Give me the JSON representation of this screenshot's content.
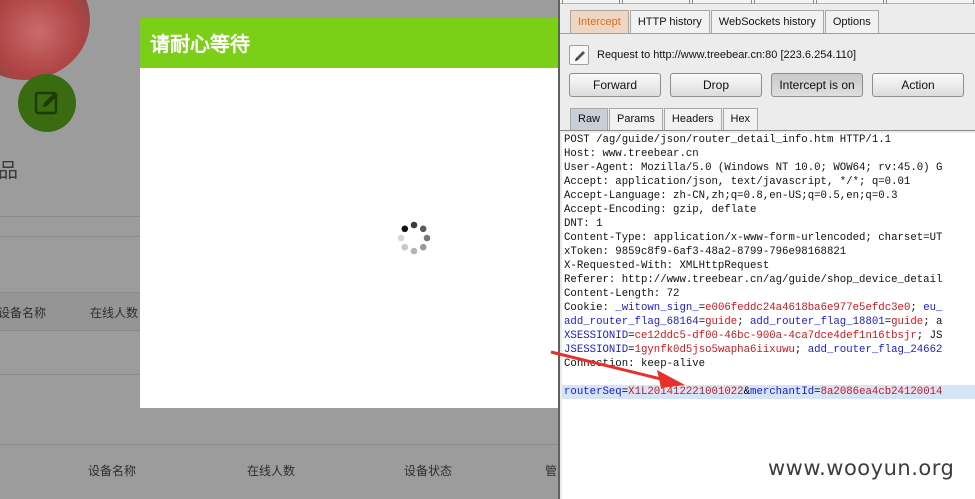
{
  "background_page": {
    "heading": "品",
    "table1_headers": [
      "设备名称",
      "在线人数"
    ],
    "table2_headers": [
      "设备名称",
      "在线人数",
      "设备状态",
      "管"
    ]
  },
  "modal": {
    "title": "请耐心等待"
  },
  "burp": {
    "subtabs": [
      {
        "label": "Intercept",
        "active": true
      },
      {
        "label": "HTTP history",
        "active": false
      },
      {
        "label": "WebSockets history",
        "active": false
      },
      {
        "label": "Options",
        "active": false
      }
    ],
    "request_info": "Request to http://www.treebear.cn:80  [223.6.254.110]",
    "buttons": {
      "forward": "Forward",
      "drop": "Drop",
      "intercept": "Intercept is on",
      "action": "Action"
    },
    "message_tabs": [
      {
        "label": "Raw",
        "active": true
      },
      {
        "label": "Params",
        "active": false
      },
      {
        "label": "Headers",
        "active": false
      },
      {
        "label": "Hex",
        "active": false
      }
    ],
    "request_lines": [
      "POST /ag/guide/json/router_detail_info.htm HTTP/1.1",
      "Host: www.treebear.cn",
      "User-Agent: Mozilla/5.0 (Windows NT 10.0; WOW64; rv:45.0) G",
      "Accept: application/json, text/javascript, */*; q=0.01",
      "Accept-Language: zh-CN,zh;q=0.8,en-US;q=0.5,en;q=0.3",
      "Accept-Encoding: gzip, deflate",
      "DNT: 1",
      "Content-Type: application/x-www-form-urlencoded; charset=UT",
      "xToken: 9859c8f9-6af3-48a2-8799-796e98168821",
      "X-Requested-With: XMLHttpRequest",
      "Referer: http://www.treebear.cn/ag/guide/shop_device_detail",
      "Content-Length: 72"
    ],
    "cookie_label": "Cookie: ",
    "cookie_lines": [
      [
        {
          "k": "_witown_sign_",
          "v": "e006feddc24a4618ba6e977e5efdc3e0"
        },
        {
          "sep": "; "
        },
        {
          "k": "eu_",
          "v": ""
        }
      ],
      [
        {
          "k": "add_router_flag_68164",
          "v": "guide"
        },
        {
          "sep": "; "
        },
        {
          "k": "add_router_flag_18801",
          "v": "guide"
        },
        {
          "sep": "; a"
        }
      ],
      [
        {
          "k": "XSESSIONID",
          "v": "ce12ddc5-df00-46bc-900a-4ca7dce4def1n16tbsjr"
        },
        {
          "sep": "; JS"
        }
      ],
      [
        {
          "k": "JSESSIONID",
          "v": "1gynfk0d5jso5wapha6iixuwu"
        },
        {
          "sep": "; "
        },
        {
          "k": "add_router_flag_24662",
          "v": ""
        }
      ]
    ],
    "connection_line": "Connection: keep-alive",
    "body_params": [
      {
        "k": "routerSeq",
        "v": "X1L201412221001022"
      },
      {
        "k": "merchantId",
        "v": "8a2086ea4cb24120014"
      }
    ]
  },
  "watermark": "www.wooyun.org",
  "colors": {
    "modal_header": "#7ccf17",
    "intercept_tab_text": "#e2691e",
    "param_key": "#1b1bd0",
    "param_value": "#d3151a",
    "arrow": "#e8302a"
  }
}
